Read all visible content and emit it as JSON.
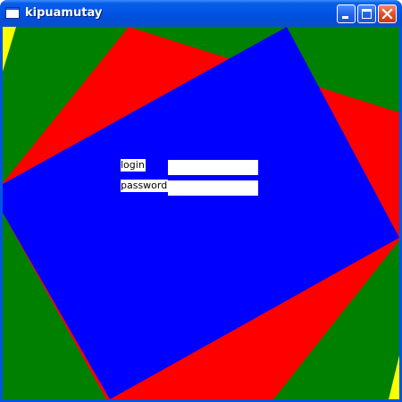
{
  "window": {
    "title": "kipuamutay",
    "icon": "window-app-icon",
    "buttons": {
      "minimize": "minimize-icon",
      "maximize": "maximize-icon",
      "close": "close-icon"
    }
  },
  "background": {
    "colors": {
      "outer": "#008000",
      "middle": "#ff0000",
      "inner": "#0000ff",
      "corner": "#ffff00"
    }
  },
  "form": {
    "login_label": "login",
    "login_value": "",
    "password_label": "password",
    "password_value": ""
  }
}
